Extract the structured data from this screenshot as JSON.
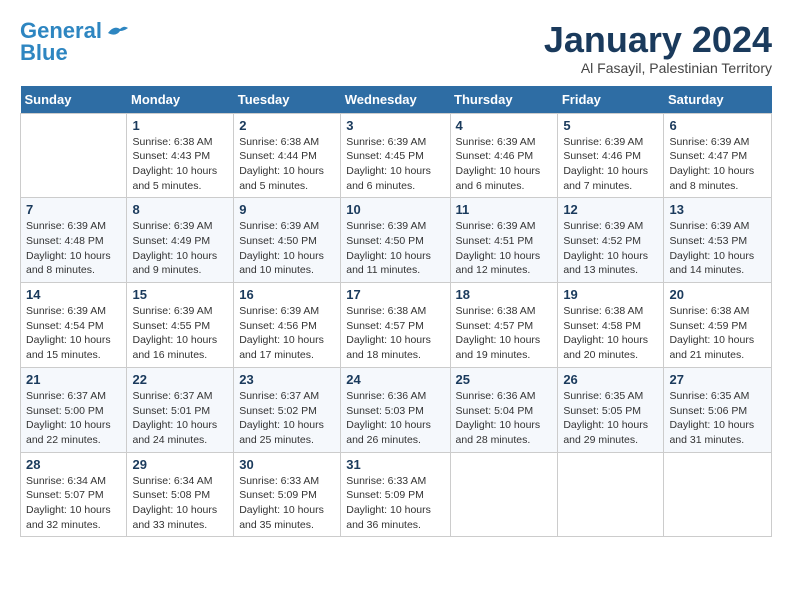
{
  "logo": {
    "line1": "General",
    "line2": "Blue"
  },
  "title": "January 2024",
  "subtitle": "Al Fasayil, Palestinian Territory",
  "weekdays": [
    "Sunday",
    "Monday",
    "Tuesday",
    "Wednesday",
    "Thursday",
    "Friday",
    "Saturday"
  ],
  "weeks": [
    [
      {
        "day": "",
        "info": ""
      },
      {
        "day": "1",
        "info": "Sunrise: 6:38 AM\nSunset: 4:43 PM\nDaylight: 10 hours\nand 5 minutes."
      },
      {
        "day": "2",
        "info": "Sunrise: 6:38 AM\nSunset: 4:44 PM\nDaylight: 10 hours\nand 5 minutes."
      },
      {
        "day": "3",
        "info": "Sunrise: 6:39 AM\nSunset: 4:45 PM\nDaylight: 10 hours\nand 6 minutes."
      },
      {
        "day": "4",
        "info": "Sunrise: 6:39 AM\nSunset: 4:46 PM\nDaylight: 10 hours\nand 6 minutes."
      },
      {
        "day": "5",
        "info": "Sunrise: 6:39 AM\nSunset: 4:46 PM\nDaylight: 10 hours\nand 7 minutes."
      },
      {
        "day": "6",
        "info": "Sunrise: 6:39 AM\nSunset: 4:47 PM\nDaylight: 10 hours\nand 8 minutes."
      }
    ],
    [
      {
        "day": "7",
        "info": "Sunrise: 6:39 AM\nSunset: 4:48 PM\nDaylight: 10 hours\nand 8 minutes."
      },
      {
        "day": "8",
        "info": "Sunrise: 6:39 AM\nSunset: 4:49 PM\nDaylight: 10 hours\nand 9 minutes."
      },
      {
        "day": "9",
        "info": "Sunrise: 6:39 AM\nSunset: 4:50 PM\nDaylight: 10 hours\nand 10 minutes."
      },
      {
        "day": "10",
        "info": "Sunrise: 6:39 AM\nSunset: 4:50 PM\nDaylight: 10 hours\nand 11 minutes."
      },
      {
        "day": "11",
        "info": "Sunrise: 6:39 AM\nSunset: 4:51 PM\nDaylight: 10 hours\nand 12 minutes."
      },
      {
        "day": "12",
        "info": "Sunrise: 6:39 AM\nSunset: 4:52 PM\nDaylight: 10 hours\nand 13 minutes."
      },
      {
        "day": "13",
        "info": "Sunrise: 6:39 AM\nSunset: 4:53 PM\nDaylight: 10 hours\nand 14 minutes."
      }
    ],
    [
      {
        "day": "14",
        "info": "Sunrise: 6:39 AM\nSunset: 4:54 PM\nDaylight: 10 hours\nand 15 minutes."
      },
      {
        "day": "15",
        "info": "Sunrise: 6:39 AM\nSunset: 4:55 PM\nDaylight: 10 hours\nand 16 minutes."
      },
      {
        "day": "16",
        "info": "Sunrise: 6:39 AM\nSunset: 4:56 PM\nDaylight: 10 hours\nand 17 minutes."
      },
      {
        "day": "17",
        "info": "Sunrise: 6:38 AM\nSunset: 4:57 PM\nDaylight: 10 hours\nand 18 minutes."
      },
      {
        "day": "18",
        "info": "Sunrise: 6:38 AM\nSunset: 4:57 PM\nDaylight: 10 hours\nand 19 minutes."
      },
      {
        "day": "19",
        "info": "Sunrise: 6:38 AM\nSunset: 4:58 PM\nDaylight: 10 hours\nand 20 minutes."
      },
      {
        "day": "20",
        "info": "Sunrise: 6:38 AM\nSunset: 4:59 PM\nDaylight: 10 hours\nand 21 minutes."
      }
    ],
    [
      {
        "day": "21",
        "info": "Sunrise: 6:37 AM\nSunset: 5:00 PM\nDaylight: 10 hours\nand 22 minutes."
      },
      {
        "day": "22",
        "info": "Sunrise: 6:37 AM\nSunset: 5:01 PM\nDaylight: 10 hours\nand 24 minutes."
      },
      {
        "day": "23",
        "info": "Sunrise: 6:37 AM\nSunset: 5:02 PM\nDaylight: 10 hours\nand 25 minutes."
      },
      {
        "day": "24",
        "info": "Sunrise: 6:36 AM\nSunset: 5:03 PM\nDaylight: 10 hours\nand 26 minutes."
      },
      {
        "day": "25",
        "info": "Sunrise: 6:36 AM\nSunset: 5:04 PM\nDaylight: 10 hours\nand 28 minutes."
      },
      {
        "day": "26",
        "info": "Sunrise: 6:35 AM\nSunset: 5:05 PM\nDaylight: 10 hours\nand 29 minutes."
      },
      {
        "day": "27",
        "info": "Sunrise: 6:35 AM\nSunset: 5:06 PM\nDaylight: 10 hours\nand 31 minutes."
      }
    ],
    [
      {
        "day": "28",
        "info": "Sunrise: 6:34 AM\nSunset: 5:07 PM\nDaylight: 10 hours\nand 32 minutes."
      },
      {
        "day": "29",
        "info": "Sunrise: 6:34 AM\nSunset: 5:08 PM\nDaylight: 10 hours\nand 33 minutes."
      },
      {
        "day": "30",
        "info": "Sunrise: 6:33 AM\nSunset: 5:09 PM\nDaylight: 10 hours\nand 35 minutes."
      },
      {
        "day": "31",
        "info": "Sunrise: 6:33 AM\nSunset: 5:09 PM\nDaylight: 10 hours\nand 36 minutes."
      },
      {
        "day": "",
        "info": ""
      },
      {
        "day": "",
        "info": ""
      },
      {
        "day": "",
        "info": ""
      }
    ]
  ]
}
